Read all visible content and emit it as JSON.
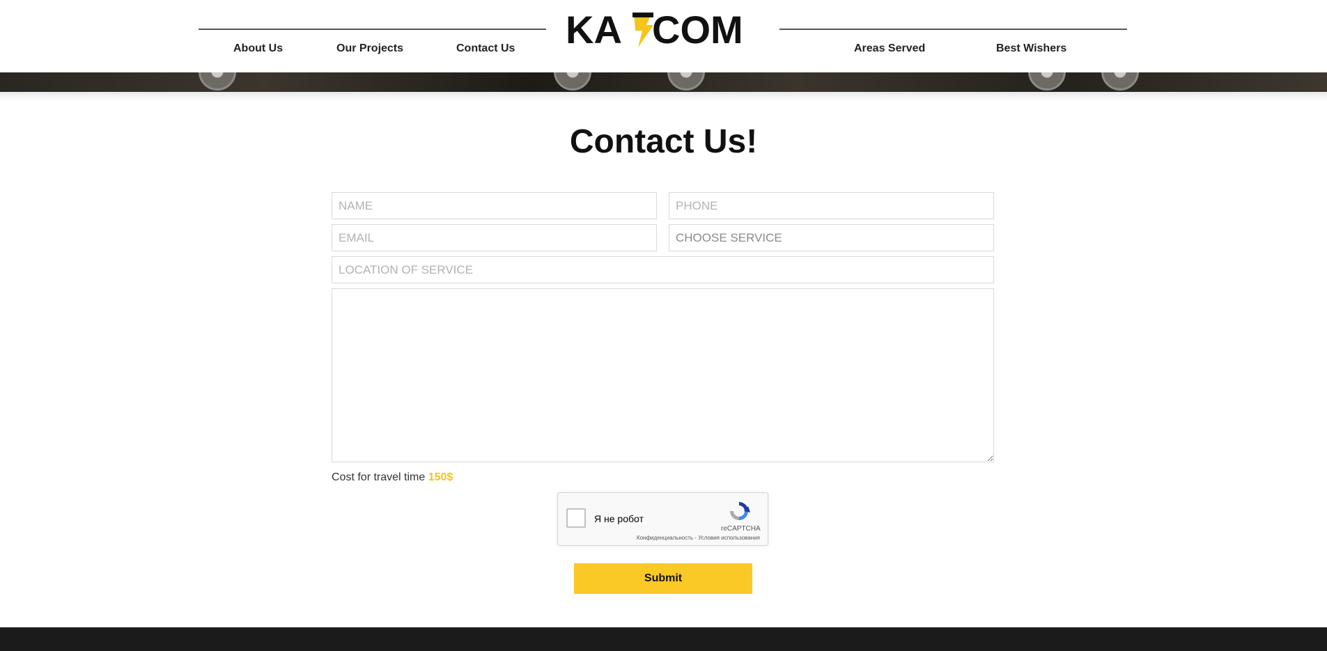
{
  "brand": {
    "logo_text_left": "KA",
    "logo_text_right": "COM",
    "accent_color": "#fbc926",
    "logo_icon": "lightning-bolt-icon"
  },
  "nav": {
    "left": [
      {
        "label": "About Us"
      },
      {
        "label": "Our Projects"
      },
      {
        "label": "Contact Us"
      }
    ],
    "right": [
      {
        "label": "Areas Served"
      },
      {
        "label": "Best Wishers"
      }
    ]
  },
  "contact": {
    "title": "Contact Us!",
    "fields": {
      "name_placeholder": "NAME",
      "phone_placeholder": "PHONE",
      "email_placeholder": "EMAIL",
      "service_selected": "CHOOSE SERVICE",
      "location_placeholder": "LOCATION OF SERVICE",
      "message_value": ""
    },
    "cost_label": "Cost for travel time",
    "cost_value": "150$",
    "captcha": {
      "label": "Я не робот",
      "brand": "reCAPTCHA",
      "terms": "Конфиденциальность - Условия использования"
    },
    "submit_label": "Submit"
  }
}
